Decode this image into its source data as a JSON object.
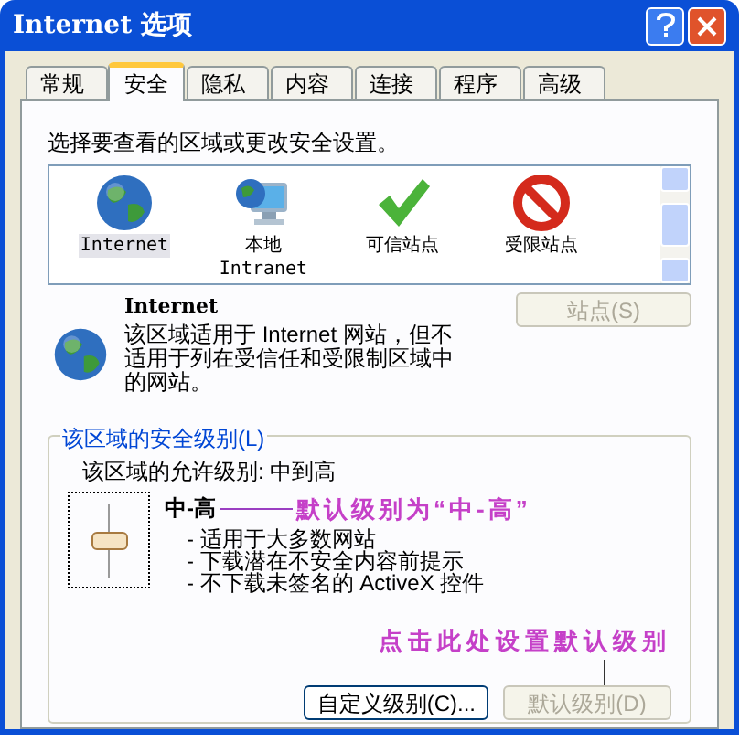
{
  "window": {
    "title": "Internet 选项"
  },
  "tabs": [
    {
      "label": "常规",
      "selected": false
    },
    {
      "label": "安全",
      "selected": true
    },
    {
      "label": "隐私",
      "selected": false
    },
    {
      "label": "内容",
      "selected": false
    },
    {
      "label": "连接",
      "selected": false
    },
    {
      "label": "程序",
      "selected": false
    },
    {
      "label": "高级",
      "selected": false
    }
  ],
  "instruction": "选择要查看的区域或更改安全设置。",
  "zones": [
    {
      "kind": "globe",
      "lines": [
        "Internet"
      ],
      "selected": true
    },
    {
      "kind": "computer",
      "lines": [
        "本地",
        "Intranet"
      ],
      "selected": false
    },
    {
      "kind": "check",
      "lines": [
        "可信站点"
      ],
      "selected": false
    },
    {
      "kind": "forbidden",
      "lines": [
        "受限站点"
      ],
      "selected": false
    }
  ],
  "zone_info": {
    "title": "Internet",
    "description": "该区域适用于 Internet 网站，但不适用于列在受信任和受限制区域中的网站。",
    "button": {
      "label": "站点(S)",
      "disabled": true
    }
  },
  "security_level": {
    "legend": "该区域的安全级别(L)",
    "allowed": "该区域的允许级别: 中到高",
    "level": 0.5,
    "level_name": "中-高",
    "bullets": [
      "- 适用于大多数网站",
      "- 下载潜在不安全内容前提示",
      "- 不下载未签名的 ActiveX 控件"
    ],
    "buttons": [
      {
        "label": "自定义级别(C)...",
        "disabled": false
      },
      {
        "label": "默认级别(D)",
        "disabled": true
      }
    ]
  },
  "annotations": [
    {
      "text": "默认级别为“中-高”"
    },
    {
      "text": "点击此处设置默认级别"
    }
  ]
}
